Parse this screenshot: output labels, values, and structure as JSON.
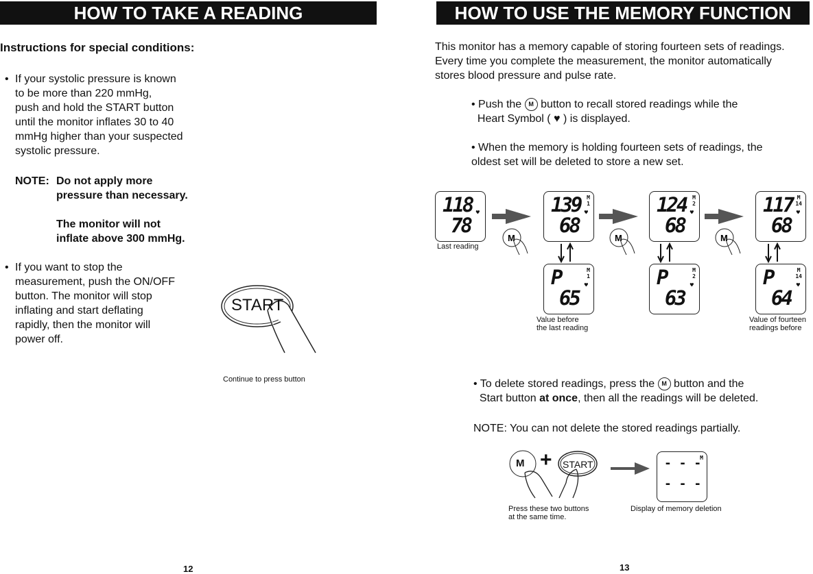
{
  "left": {
    "title": "HOW TO TAKE A READING",
    "subtitle": "Instructions for special conditions:",
    "bullet1": [
      "If your systolic pressure is known",
      "to be more than 220 mmHg,",
      "push and hold the START button",
      "until the monitor inflates 30 to 40",
      "mmHg higher than your suspected",
      "systolic pressure."
    ],
    "note_label": "NOTE:",
    "note1": [
      "Do not apply more",
      "pressure than necessary."
    ],
    "note2": [
      "The monitor will not",
      "inflate above 300 mmHg."
    ],
    "bullet2": [
      "If you want to stop the",
      "measurement, push the ON/OFF",
      "button. The monitor will stop",
      "inflating and start deflating",
      "rapidly, then the monitor will",
      "power off."
    ],
    "start_label": "START",
    "start_caption": "Continue to press button",
    "page": "12"
  },
  "right": {
    "title": "HOW TO USE THE MEMORY FUNCTION",
    "intro": [
      "This monitor has a memory capable of storing fourteen sets of readings.",
      "Every time you complete the measurement, the monitor automatically",
      "stores blood pressure and pulse rate."
    ],
    "b1a": "• Push the",
    "m": "M",
    "b1b": "button to recall stored readings while the",
    "b1c": "Heart Symbol (",
    "b1d": ") is displayed.",
    "b2": [
      "• When the memory is holding fourteen sets of readings, the",
      "oldest set will be deleted to store a new set."
    ],
    "displays_top": [
      {
        "sys": "118",
        "dia": "78",
        "mem": ""
      },
      {
        "sys": "139",
        "dia": "68",
        "mem": "1"
      },
      {
        "sys": "124",
        "dia": "68",
        "mem": "2"
      },
      {
        "sys": "117",
        "dia": "68",
        "mem": "14"
      }
    ],
    "displays_pulse": [
      {
        "p": "P",
        "pulse": "65",
        "mem": "1"
      },
      {
        "p": "P",
        "pulse": "63",
        "mem": "2"
      },
      {
        "p": "P",
        "pulse": "64",
        "mem": "14"
      }
    ],
    "cap_last": "Last reading",
    "cap_before": [
      "Value before",
      "the last reading"
    ],
    "cap_fourteen": [
      "Value of fourteen",
      "readings before"
    ],
    "b3a": "• To delete stored readings, press the",
    "b3b": "button and the",
    "b3c": "Start button ",
    "b3d": "at once",
    "b3e": ", then all the readings will be deleted.",
    "note": "NOTE: You can not delete the stored readings partially.",
    "plus": "+",
    "start_label": "START",
    "delete_display": [
      "- - -",
      "- - -"
    ],
    "cap_press": [
      "Press these two buttons",
      "at the same time."
    ],
    "cap_deletion": "Display of memory deletion",
    "page": "13"
  }
}
